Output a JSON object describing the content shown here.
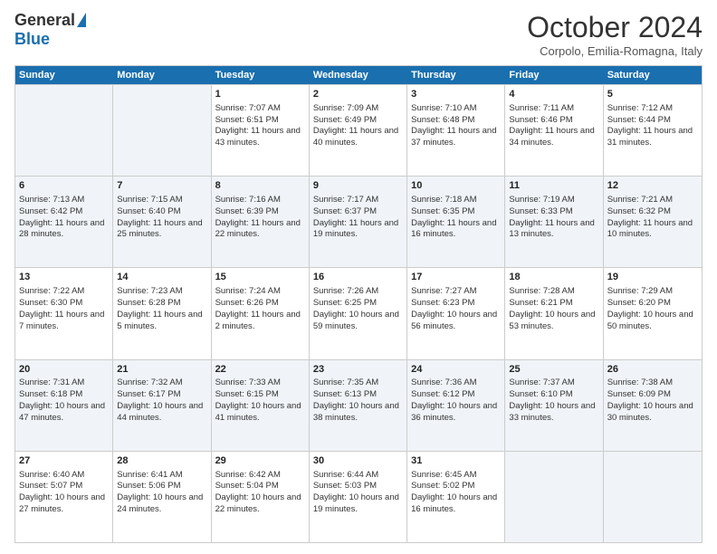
{
  "logo": {
    "general": "General",
    "blue": "Blue"
  },
  "title": "October 2024",
  "location": "Corpolo, Emilia-Romagna, Italy",
  "weekdays": [
    "Sunday",
    "Monday",
    "Tuesday",
    "Wednesday",
    "Thursday",
    "Friday",
    "Saturday"
  ],
  "rows": [
    [
      {
        "day": "",
        "sunrise": "",
        "sunset": "",
        "daylight": ""
      },
      {
        "day": "",
        "sunrise": "",
        "sunset": "",
        "daylight": ""
      },
      {
        "day": "1",
        "sunrise": "Sunrise: 7:07 AM",
        "sunset": "Sunset: 6:51 PM",
        "daylight": "Daylight: 11 hours and 43 minutes."
      },
      {
        "day": "2",
        "sunrise": "Sunrise: 7:09 AM",
        "sunset": "Sunset: 6:49 PM",
        "daylight": "Daylight: 11 hours and 40 minutes."
      },
      {
        "day": "3",
        "sunrise": "Sunrise: 7:10 AM",
        "sunset": "Sunset: 6:48 PM",
        "daylight": "Daylight: 11 hours and 37 minutes."
      },
      {
        "day": "4",
        "sunrise": "Sunrise: 7:11 AM",
        "sunset": "Sunset: 6:46 PM",
        "daylight": "Daylight: 11 hours and 34 minutes."
      },
      {
        "day": "5",
        "sunrise": "Sunrise: 7:12 AM",
        "sunset": "Sunset: 6:44 PM",
        "daylight": "Daylight: 11 hours and 31 minutes."
      }
    ],
    [
      {
        "day": "6",
        "sunrise": "Sunrise: 7:13 AM",
        "sunset": "Sunset: 6:42 PM",
        "daylight": "Daylight: 11 hours and 28 minutes."
      },
      {
        "day": "7",
        "sunrise": "Sunrise: 7:15 AM",
        "sunset": "Sunset: 6:40 PM",
        "daylight": "Daylight: 11 hours and 25 minutes."
      },
      {
        "day": "8",
        "sunrise": "Sunrise: 7:16 AM",
        "sunset": "Sunset: 6:39 PM",
        "daylight": "Daylight: 11 hours and 22 minutes."
      },
      {
        "day": "9",
        "sunrise": "Sunrise: 7:17 AM",
        "sunset": "Sunset: 6:37 PM",
        "daylight": "Daylight: 11 hours and 19 minutes."
      },
      {
        "day": "10",
        "sunrise": "Sunrise: 7:18 AM",
        "sunset": "Sunset: 6:35 PM",
        "daylight": "Daylight: 11 hours and 16 minutes."
      },
      {
        "day": "11",
        "sunrise": "Sunrise: 7:19 AM",
        "sunset": "Sunset: 6:33 PM",
        "daylight": "Daylight: 11 hours and 13 minutes."
      },
      {
        "day": "12",
        "sunrise": "Sunrise: 7:21 AM",
        "sunset": "Sunset: 6:32 PM",
        "daylight": "Daylight: 11 hours and 10 minutes."
      }
    ],
    [
      {
        "day": "13",
        "sunrise": "Sunrise: 7:22 AM",
        "sunset": "Sunset: 6:30 PM",
        "daylight": "Daylight: 11 hours and 7 minutes."
      },
      {
        "day": "14",
        "sunrise": "Sunrise: 7:23 AM",
        "sunset": "Sunset: 6:28 PM",
        "daylight": "Daylight: 11 hours and 5 minutes."
      },
      {
        "day": "15",
        "sunrise": "Sunrise: 7:24 AM",
        "sunset": "Sunset: 6:26 PM",
        "daylight": "Daylight: 11 hours and 2 minutes."
      },
      {
        "day": "16",
        "sunrise": "Sunrise: 7:26 AM",
        "sunset": "Sunset: 6:25 PM",
        "daylight": "Daylight: 10 hours and 59 minutes."
      },
      {
        "day": "17",
        "sunrise": "Sunrise: 7:27 AM",
        "sunset": "Sunset: 6:23 PM",
        "daylight": "Daylight: 10 hours and 56 minutes."
      },
      {
        "day": "18",
        "sunrise": "Sunrise: 7:28 AM",
        "sunset": "Sunset: 6:21 PM",
        "daylight": "Daylight: 10 hours and 53 minutes."
      },
      {
        "day": "19",
        "sunrise": "Sunrise: 7:29 AM",
        "sunset": "Sunset: 6:20 PM",
        "daylight": "Daylight: 10 hours and 50 minutes."
      }
    ],
    [
      {
        "day": "20",
        "sunrise": "Sunrise: 7:31 AM",
        "sunset": "Sunset: 6:18 PM",
        "daylight": "Daylight: 10 hours and 47 minutes."
      },
      {
        "day": "21",
        "sunrise": "Sunrise: 7:32 AM",
        "sunset": "Sunset: 6:17 PM",
        "daylight": "Daylight: 10 hours and 44 minutes."
      },
      {
        "day": "22",
        "sunrise": "Sunrise: 7:33 AM",
        "sunset": "Sunset: 6:15 PM",
        "daylight": "Daylight: 10 hours and 41 minutes."
      },
      {
        "day": "23",
        "sunrise": "Sunrise: 7:35 AM",
        "sunset": "Sunset: 6:13 PM",
        "daylight": "Daylight: 10 hours and 38 minutes."
      },
      {
        "day": "24",
        "sunrise": "Sunrise: 7:36 AM",
        "sunset": "Sunset: 6:12 PM",
        "daylight": "Daylight: 10 hours and 36 minutes."
      },
      {
        "day": "25",
        "sunrise": "Sunrise: 7:37 AM",
        "sunset": "Sunset: 6:10 PM",
        "daylight": "Daylight: 10 hours and 33 minutes."
      },
      {
        "day": "26",
        "sunrise": "Sunrise: 7:38 AM",
        "sunset": "Sunset: 6:09 PM",
        "daylight": "Daylight: 10 hours and 30 minutes."
      }
    ],
    [
      {
        "day": "27",
        "sunrise": "Sunrise: 6:40 AM",
        "sunset": "Sunset: 5:07 PM",
        "daylight": "Daylight: 10 hours and 27 minutes."
      },
      {
        "day": "28",
        "sunrise": "Sunrise: 6:41 AM",
        "sunset": "Sunset: 5:06 PM",
        "daylight": "Daylight: 10 hours and 24 minutes."
      },
      {
        "day": "29",
        "sunrise": "Sunrise: 6:42 AM",
        "sunset": "Sunset: 5:04 PM",
        "daylight": "Daylight: 10 hours and 22 minutes."
      },
      {
        "day": "30",
        "sunrise": "Sunrise: 6:44 AM",
        "sunset": "Sunset: 5:03 PM",
        "daylight": "Daylight: 10 hours and 19 minutes."
      },
      {
        "day": "31",
        "sunrise": "Sunrise: 6:45 AM",
        "sunset": "Sunset: 5:02 PM",
        "daylight": "Daylight: 10 hours and 16 minutes."
      },
      {
        "day": "",
        "sunrise": "",
        "sunset": "",
        "daylight": ""
      },
      {
        "day": "",
        "sunrise": "",
        "sunset": "",
        "daylight": ""
      }
    ]
  ]
}
